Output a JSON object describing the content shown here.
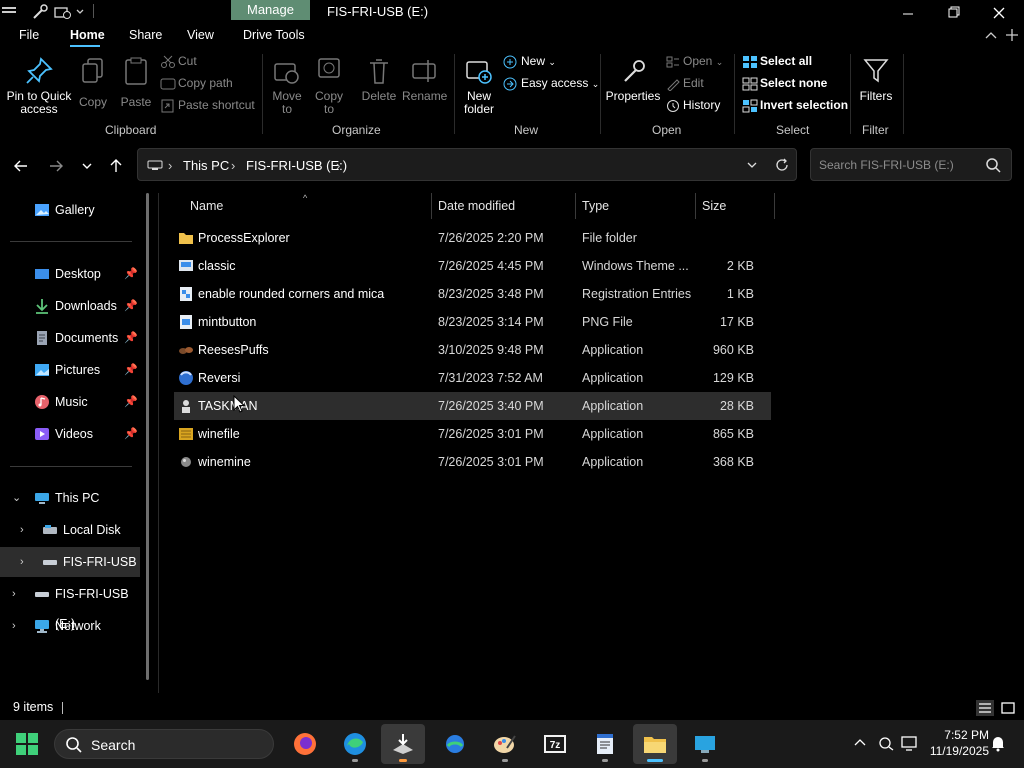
{
  "titlebar": {
    "manage_label": "Manage",
    "window_title": "FIS-FRI-USB (E:)"
  },
  "menu_tabs": [
    "File",
    "Home",
    "Share",
    "View",
    "Drive Tools"
  ],
  "ribbon": {
    "clipboard": {
      "pin_label": "Pin to Quick access",
      "copy_label": "Copy",
      "paste_label": "Paste",
      "cut_label": "Cut",
      "copy_path_label": "Copy path",
      "paste_shortcut_label": "Paste shortcut",
      "group_label": "Clipboard"
    },
    "organize": {
      "move_to_label": "Move to",
      "copy_to_label": "Copy to",
      "delete_label": "Delete",
      "rename_label": "Rename",
      "group_label": "Organize"
    },
    "new": {
      "new_folder_label": "New folder",
      "new_item_label": "New",
      "easy_access_label": "Easy access",
      "group_label": "New"
    },
    "open": {
      "properties_label": "Properties",
      "open_label": "Open",
      "edit_label": "Edit",
      "history_label": "History",
      "group_label": "Open"
    },
    "select": {
      "select_all_label": "Select all",
      "select_none_label": "Select none",
      "invert_label": "Invert selection",
      "group_label": "Select"
    },
    "filter": {
      "filters_label": "Filters",
      "group_label": "Filter"
    }
  },
  "address": {
    "crumbs": [
      "This PC",
      "FIS-FRI-USB (E:)"
    ],
    "search_placeholder": "Search FIS-FRI-USB (E:)"
  },
  "nav": {
    "gallery": "Gallery",
    "quick": [
      {
        "label": "Desktop",
        "icon": "desktop-icon"
      },
      {
        "label": "Downloads",
        "icon": "download-icon"
      },
      {
        "label": "Documents",
        "icon": "documents-icon"
      },
      {
        "label": "Pictures",
        "icon": "pictures-icon"
      },
      {
        "label": "Music",
        "icon": "music-icon"
      },
      {
        "label": "Videos",
        "icon": "videos-icon"
      }
    ],
    "this_pc": "This PC",
    "local_disk": "Local Disk (C:)",
    "usb_child": "FIS-FRI-USB (E:)",
    "usb_root": "FIS-FRI-USB (E:)",
    "network": "Network"
  },
  "columns": {
    "name": "Name",
    "date": "Date modified",
    "type": "Type",
    "size": "Size"
  },
  "files": [
    {
      "name": "ProcessExplorer",
      "date": "7/26/2025 2:20 PM",
      "type": "File folder",
      "size": "",
      "icon": "folder-icon"
    },
    {
      "name": "classic",
      "date": "7/26/2025 4:45 PM",
      "type": "Windows Theme ...",
      "size": "2 KB",
      "icon": "theme-file-icon"
    },
    {
      "name": "enable rounded corners and mica",
      "date": "8/23/2025 3:48 PM",
      "type": "Registration Entries",
      "size": "1 KB",
      "icon": "registry-file-icon"
    },
    {
      "name": "mintbutton",
      "date": "8/23/2025 3:14 PM",
      "type": "PNG File",
      "size": "17 KB",
      "icon": "png-file-icon"
    },
    {
      "name": "ReesesPuffs",
      "date": "3/10/2025 9:48 PM",
      "type": "Application",
      "size": "960 KB",
      "icon": "reesespuffs-app-icon"
    },
    {
      "name": "Reversi",
      "date": "7/31/2023 7:52 AM",
      "type": "Application",
      "size": "129 KB",
      "icon": "reversi-app-icon"
    },
    {
      "name": "TASKMAN",
      "date": "7/26/2025 3:40 PM",
      "type": "Application",
      "size": "28 KB",
      "icon": "taskman-app-icon"
    },
    {
      "name": "winefile",
      "date": "7/26/2025 3:01 PM",
      "type": "Application",
      "size": "865 KB",
      "icon": "winefile-app-icon"
    },
    {
      "name": "winemine",
      "date": "7/26/2025 3:01 PM",
      "type": "Application",
      "size": "368 KB",
      "icon": "winemine-app-icon"
    }
  ],
  "status": {
    "items_count": "9 items"
  },
  "taskbar": {
    "search_label": "Search",
    "time": "7:52 PM",
    "date": "11/19/2025",
    "apps": [
      "firefox-icon",
      "edge-icon",
      "installer-icon",
      "network-app-icon",
      "paint-icon",
      "7zip-icon",
      "notepad-icon",
      "file-explorer-icon",
      "rdp-icon"
    ]
  },
  "colors": {
    "accent": "#4cc2ff",
    "manage_tab": "#5f8d73",
    "folder": "#f0c14b"
  }
}
